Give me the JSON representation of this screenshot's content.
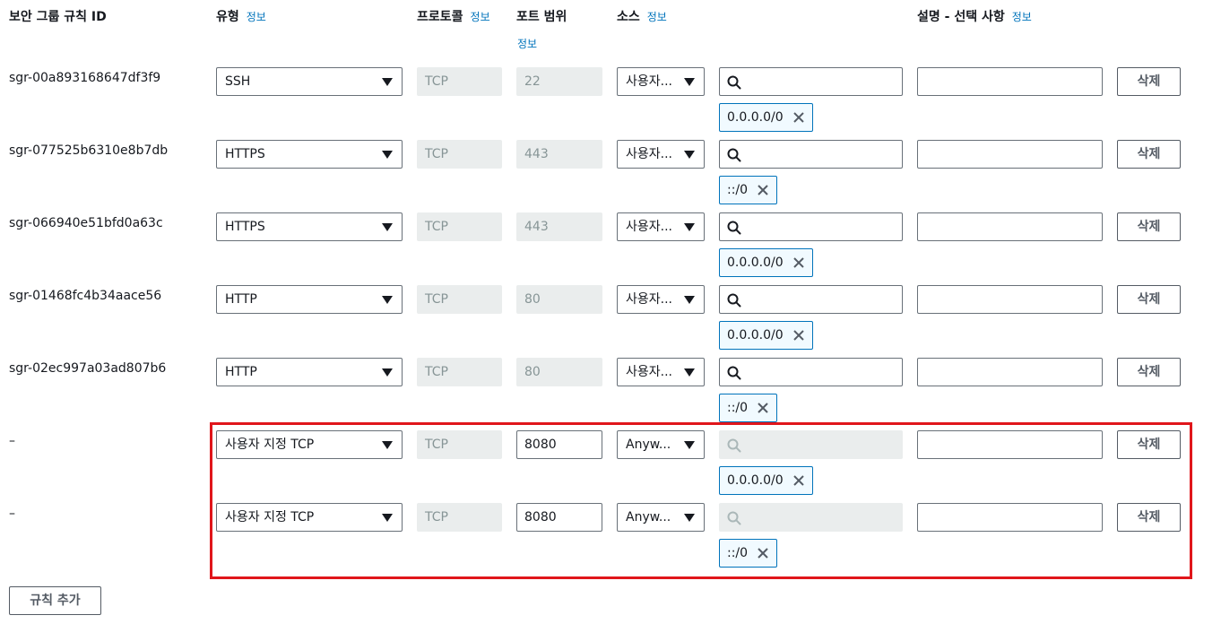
{
  "headers": {
    "id": "보안 그룹 규칙 ID",
    "type": "유형",
    "protocol": "프로토콜",
    "port_range": "포트 범위",
    "source": "소스",
    "description": "설명 - 선택 사항",
    "info": "정보"
  },
  "rules": [
    {
      "id": "sgr-00a893168647df3f9",
      "type": "SSH",
      "protocol": "TCP",
      "port": "22",
      "port_editable": false,
      "source": "사용자...",
      "search_enabled": true,
      "cidr": "0.0.0.0/0",
      "description": "",
      "delete": "삭제"
    },
    {
      "id": "sgr-077525b6310e8b7db",
      "type": "HTTPS",
      "protocol": "TCP",
      "port": "443",
      "port_editable": false,
      "source": "사용자...",
      "search_enabled": true,
      "cidr": "::/0",
      "description": "",
      "delete": "삭제"
    },
    {
      "id": "sgr-066940e51bfd0a63c",
      "type": "HTTPS",
      "protocol": "TCP",
      "port": "443",
      "port_editable": false,
      "source": "사용자...",
      "search_enabled": true,
      "cidr": "0.0.0.0/0",
      "description": "",
      "delete": "삭제"
    },
    {
      "id": "sgr-01468fc4b34aace56",
      "type": "HTTP",
      "protocol": "TCP",
      "port": "80",
      "port_editable": false,
      "source": "사용자...",
      "search_enabled": true,
      "cidr": "0.0.0.0/0",
      "description": "",
      "delete": "삭제"
    },
    {
      "id": "sgr-02ec997a03ad807b6",
      "type": "HTTP",
      "protocol": "TCP",
      "port": "80",
      "port_editable": false,
      "source": "사용자...",
      "search_enabled": true,
      "cidr": "::/0",
      "description": "",
      "delete": "삭제"
    },
    {
      "id": "–",
      "type": "사용자 지정 TCP",
      "protocol": "TCP",
      "port": "8080",
      "port_editable": true,
      "source": "Anyw...",
      "search_enabled": false,
      "cidr": "0.0.0.0/0",
      "description": "",
      "delete": "삭제"
    },
    {
      "id": "–",
      "type": "사용자 지정 TCP",
      "protocol": "TCP",
      "port": "8080",
      "port_editable": true,
      "source": "Anyw...",
      "search_enabled": false,
      "cidr": "::/0",
      "description": "",
      "delete": "삭제"
    }
  ],
  "add_rule_label": "규칙 추가",
  "colors": {
    "link": "#0073bb",
    "highlight": "#e0161b",
    "token_border": "#0073bb",
    "readonly_bg": "#eaeded"
  }
}
